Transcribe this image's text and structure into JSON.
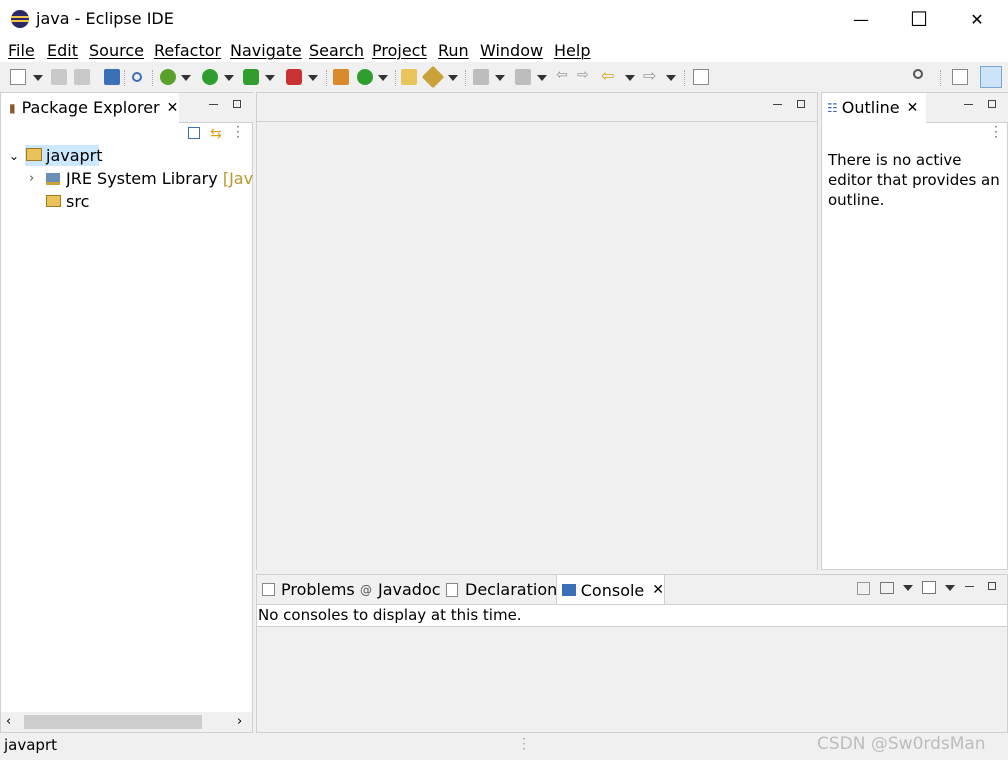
{
  "window": {
    "title": "java - Eclipse IDE",
    "minimize": "—",
    "maximize": "☐",
    "close": "✕"
  },
  "menu": [
    "File",
    "Edit",
    "Source",
    "Refactor",
    "Navigate",
    "Search",
    "Project",
    "Run",
    "Window",
    "Help"
  ],
  "package_explorer": {
    "tab_label": "Package Explorer",
    "tree": {
      "project": "javaprt",
      "jre_label": "JRE System Library",
      "jre_suffix": "[JavaS",
      "src": "src"
    }
  },
  "outline": {
    "tab_label": "Outline",
    "message": "There is no active editor that provides an outline."
  },
  "bottom_tabs": {
    "problems": "Problems",
    "javadoc": "Javadoc",
    "declaration": "Declaration",
    "console": "Console"
  },
  "console": {
    "message": "No consoles to display at this time."
  },
  "status": {
    "text": "javaprt"
  },
  "watermark": "CSDN @Sw0rdsMan",
  "colors": {
    "accent": "#1a6fd6",
    "selection": "#cce8ff",
    "panel_border": "#d0d0d0",
    "jre_suffix": "#b8962a"
  }
}
